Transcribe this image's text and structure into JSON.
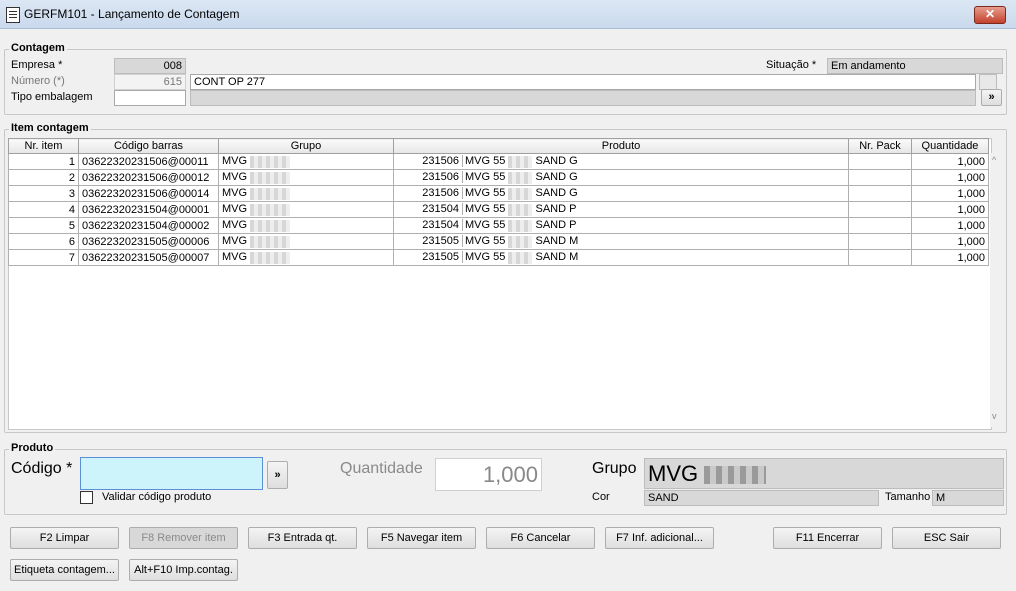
{
  "window": {
    "title": "GERFM101 - Lançamento de Contagem",
    "close": "✕"
  },
  "contagem": {
    "section_title": "Contagem",
    "empresa_label": "Empresa *",
    "empresa_value": "008",
    "numero_label": "Número (*)",
    "numero_value": "615",
    "descricao_value": "CONT OP 277",
    "tipo_embalagem_label": "Tipo embalagem",
    "tipo_embalagem_value": "",
    "situacao_label": "Situação *",
    "situacao_value": "Em andamento",
    "lookup_button": "»"
  },
  "item_contagem": {
    "section_title": "Item contagem",
    "columns": [
      "Nr. item",
      "Código barras",
      "Grupo",
      "Produto",
      "Nr. Pack",
      "Quantidade"
    ],
    "rows": [
      {
        "nr": "1",
        "codigo": "03622320231506@00011",
        "grupo": "MVG",
        "prod_cod": "231506",
        "prod_a": "MVG 55",
        "prod_b": "SAND G",
        "pack": "",
        "qtd": "1,000"
      },
      {
        "nr": "2",
        "codigo": "03622320231506@00012",
        "grupo": "MVG",
        "prod_cod": "231506",
        "prod_a": "MVG 55",
        "prod_b": "SAND G",
        "pack": "",
        "qtd": "1,000"
      },
      {
        "nr": "3",
        "codigo": "03622320231506@00014",
        "grupo": "MVG",
        "prod_cod": "231506",
        "prod_a": "MVG 55",
        "prod_b": "SAND G",
        "pack": "",
        "qtd": "1,000"
      },
      {
        "nr": "4",
        "codigo": "03622320231504@00001",
        "grupo": "MVG",
        "prod_cod": "231504",
        "prod_a": "MVG 55",
        "prod_b": "SAND P",
        "pack": "",
        "qtd": "1,000"
      },
      {
        "nr": "5",
        "codigo": "03622320231504@00002",
        "grupo": "MVG",
        "prod_cod": "231504",
        "prod_a": "MVG 55",
        "prod_b": "SAND P",
        "pack": "",
        "qtd": "1,000"
      },
      {
        "nr": "6",
        "codigo": "03622320231505@00006",
        "grupo": "MVG",
        "prod_cod": "231505",
        "prod_a": "MVG 55",
        "prod_b": "SAND M",
        "pack": "",
        "qtd": "1,000"
      },
      {
        "nr": "7",
        "codigo": "03622320231505@00007",
        "grupo": "MVG",
        "prod_cod": "231505",
        "prod_a": "MVG 55",
        "prod_b": "SAND M",
        "pack": "",
        "qtd": "1,000"
      }
    ]
  },
  "produto": {
    "section_title": "Produto",
    "codigo_label": "Código *",
    "codigo_value": "",
    "validar_label": "Validar código produto",
    "quantidade_label": "Quantidade",
    "quantidade_value": "1,000",
    "grupo_label": "Grupo",
    "grupo_value": "MVG",
    "cor_label": "Cor",
    "cor_value": "SAND",
    "tamanho_label": "Tamanho",
    "tamanho_value": "M",
    "lookup_button": "»"
  },
  "buttons": {
    "limpar": "F2 Limpar",
    "remover": "F8 Remover item",
    "entrada": "F3 Entrada qt.",
    "navegar": "F5 Navegar item",
    "cancelar": "F6 Cancelar",
    "inf_adicional": "F7 Inf. adicional...",
    "encerrar": "F11 Encerrar",
    "sair": "ESC Sair",
    "etiqueta": "Etiqueta contagem...",
    "imp_contag": "Alt+F10 Imp.contag."
  },
  "colors": {
    "input_focus": "#cdf3fb",
    "readonly": "#d8d8d8"
  }
}
